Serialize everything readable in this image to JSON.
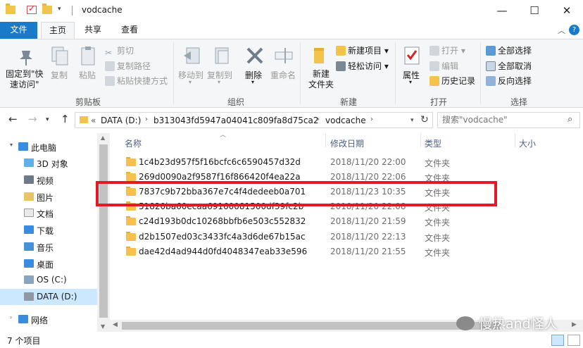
{
  "window": {
    "title": "vodcache",
    "controls": {
      "minimize": "—",
      "maximize": "☐",
      "close": "✕"
    }
  },
  "ribbon_tabs": {
    "file": "文件",
    "home": "主页",
    "share": "共享",
    "view": "查看"
  },
  "ribbon": {
    "clipboard": {
      "label": "剪贴板",
      "pin": "固定到\"快\n速访问\"",
      "pin_line1": "固定到\"快",
      "pin_line2": "速访问\"",
      "copy": "复制",
      "paste": "粘贴",
      "cut": "剪切",
      "copy_path": "复制路径",
      "paste_shortcut": "粘贴快捷方式"
    },
    "organize": {
      "label": "组织",
      "move_to": "移动到",
      "copy_to": "复制到",
      "delete": "删除",
      "rename": "重命名"
    },
    "new": {
      "label": "新建",
      "new_folder_line1": "新建",
      "new_folder_line2": "文件夹",
      "new_item": "新建项目",
      "easy_access": "轻松访问"
    },
    "open": {
      "label": "打开",
      "properties": "属性",
      "open": "打开",
      "edit": "编辑",
      "history": "历史记录"
    },
    "select": {
      "label": "选择",
      "select_all": "全部选择",
      "select_none": "全部取消",
      "invert": "反向选择"
    }
  },
  "address": {
    "prefix": "«",
    "crumbs": [
      "DATA (D:)",
      "b313043fd5947a04041c809fa8d75ca2",
      "vodcache"
    ],
    "search_placeholder": "搜索\"vodcache\""
  },
  "nav": {
    "items": [
      {
        "label": "此电脑"
      },
      {
        "label": "3D 对象"
      },
      {
        "label": "视频"
      },
      {
        "label": "图片"
      },
      {
        "label": "文档"
      },
      {
        "label": "下载"
      },
      {
        "label": "音乐"
      },
      {
        "label": "桌面"
      },
      {
        "label": "OS (C:)"
      },
      {
        "label": "DATA (D:)"
      },
      {
        "label": "网络"
      }
    ]
  },
  "columns": {
    "name": "名称",
    "date": "修改日期",
    "type": "类型",
    "size": "大小"
  },
  "files": [
    {
      "name": "1c4b23d957f5f16bcfc6c6590457d32d",
      "date": "2018/11/20 22:00",
      "type": "文件夹"
    },
    {
      "name": "269d0090a2f9587f16f866420f4ea22a",
      "date": "2018/11/20 22:06",
      "type": "文件夹"
    },
    {
      "name": "7837c9b72bba367e7c4f4dedeeb0a701",
      "date": "2018/11/23 10:35",
      "type": "文件夹"
    },
    {
      "name": "51820ba60ecaa69160081500df39fc2b",
      "date": "2018/11/20 22:08",
      "type": "文件夹"
    },
    {
      "name": "c24d193b0dc10268bbfb6e503c552832",
      "date": "2018/11/20 21:59",
      "type": "文件夹"
    },
    {
      "name": "d2b1507ed03c3433fc4a3d6de67b15ac",
      "date": "2018/11/20 22:13",
      "type": "文件夹"
    },
    {
      "name": "dae42d4ad944d0fd4048347eab33e596",
      "date": "2018/11/20 21:55",
      "type": "文件夹"
    }
  ],
  "status": {
    "count": "7 个项目"
  },
  "watermark": "慢热and怪人",
  "colors": {
    "accent": "#1979ca",
    "highlight": "#e01b24",
    "folder": "#f5c04d",
    "selected": "#cce8ff"
  }
}
